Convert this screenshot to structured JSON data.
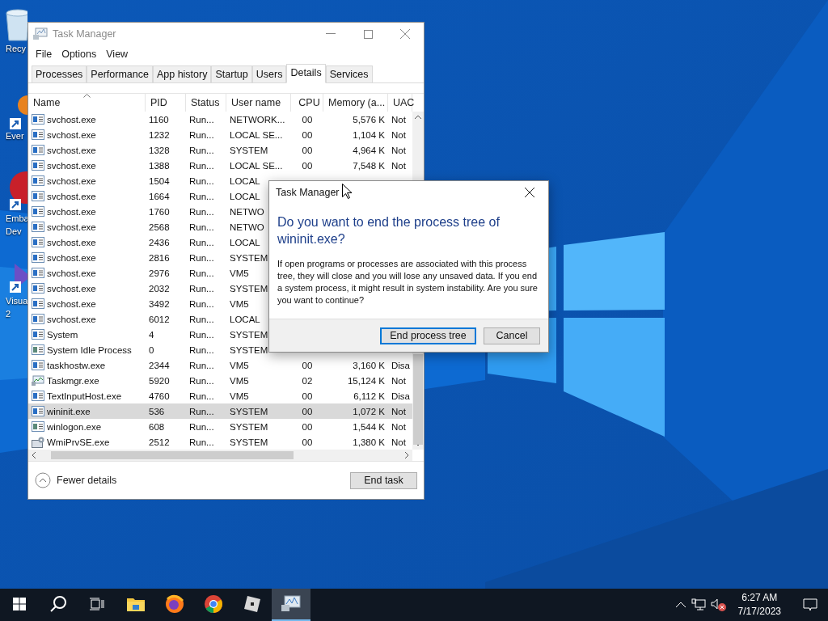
{
  "desktop": {
    "icons": [
      {
        "kind": "recycle",
        "lines": [
          "Recy"
        ]
      },
      {
        "kind": "evernote",
        "lines": [
          "Ever"
        ]
      },
      {
        "kind": "embarcadero",
        "lines": [
          "Emba",
          "Dev"
        ]
      },
      {
        "kind": "visualstudio",
        "lines": [
          "Visua",
          "2"
        ]
      }
    ]
  },
  "task_manager": {
    "title": "Task Manager",
    "menu": [
      "File",
      "Options",
      "View"
    ],
    "tabs": [
      {
        "label": "Processes",
        "selected": false
      },
      {
        "label": "Performance",
        "selected": false
      },
      {
        "label": "App history",
        "selected": false
      },
      {
        "label": "Startup",
        "selected": false
      },
      {
        "label": "Users",
        "selected": false
      },
      {
        "label": "Details",
        "selected": true
      },
      {
        "label": "Services",
        "selected": false
      }
    ],
    "columns": [
      {
        "label": "Name",
        "sorted": true
      },
      {
        "label": "PID",
        "sorted": false
      },
      {
        "label": "Status",
        "sorted": false
      },
      {
        "label": "User name",
        "sorted": false
      },
      {
        "label": "CPU",
        "sorted": false
      },
      {
        "label": "Memory (a...",
        "sorted": false
      },
      {
        "label": "UAC",
        "sorted": false
      }
    ],
    "rows": [
      {
        "kind": "app",
        "name": "svchost.exe",
        "pid": "1160",
        "status": "Run...",
        "user": "NETWORK...",
        "cpu": "00",
        "memory": "5,576 K",
        "uac": "Not",
        "selected": false
      },
      {
        "kind": "app",
        "name": "svchost.exe",
        "pid": "1232",
        "status": "Run...",
        "user": "LOCAL SE...",
        "cpu": "00",
        "memory": "1,104 K",
        "uac": "Not",
        "selected": false
      },
      {
        "kind": "app",
        "name": "svchost.exe",
        "pid": "1328",
        "status": "Run...",
        "user": "SYSTEM",
        "cpu": "00",
        "memory": "4,964 K",
        "uac": "Not",
        "selected": false
      },
      {
        "kind": "app",
        "name": "svchost.exe",
        "pid": "1388",
        "status": "Run...",
        "user": "LOCAL SE...",
        "cpu": "00",
        "memory": "7,548 K",
        "uac": "Not",
        "selected": false
      },
      {
        "kind": "app",
        "name": "svchost.exe",
        "pid": "1504",
        "status": "Run...",
        "user": "LOCAL",
        "selected": false
      },
      {
        "kind": "app",
        "name": "svchost.exe",
        "pid": "1664",
        "status": "Run...",
        "user": "LOCAL",
        "selected": false
      },
      {
        "kind": "app",
        "name": "svchost.exe",
        "pid": "1760",
        "status": "Run...",
        "user": "NETWO",
        "selected": false
      },
      {
        "kind": "app",
        "name": "svchost.exe",
        "pid": "2568",
        "status": "Run...",
        "user": "NETWO",
        "selected": false
      },
      {
        "kind": "app",
        "name": "svchost.exe",
        "pid": "2436",
        "status": "Run...",
        "user": "LOCAL",
        "selected": false
      },
      {
        "kind": "app",
        "name": "svchost.exe",
        "pid": "2816",
        "status": "Run...",
        "user": "SYSTEM",
        "selected": false
      },
      {
        "kind": "app",
        "name": "svchost.exe",
        "pid": "2976",
        "status": "Run...",
        "user": "VM5",
        "selected": false
      },
      {
        "kind": "app",
        "name": "svchost.exe",
        "pid": "2032",
        "status": "Run...",
        "user": "SYSTEM",
        "selected": false
      },
      {
        "kind": "app",
        "name": "svchost.exe",
        "pid": "3492",
        "status": "Run...",
        "user": "VM5",
        "selected": false
      },
      {
        "kind": "app",
        "name": "svchost.exe",
        "pid": "6012",
        "status": "Run...",
        "user": "LOCAL",
        "selected": false
      },
      {
        "kind": "app",
        "name": "System",
        "pid": "4",
        "status": "Run...",
        "user": "SYSTEM",
        "selected": false
      },
      {
        "kind": "idle",
        "name": "System Idle Process",
        "pid": "0",
        "status": "Run...",
        "user": "SYSTEM",
        "selected": false
      },
      {
        "kind": "app",
        "name": "taskhostw.exe",
        "pid": "2344",
        "status": "Run...",
        "user": "VM5",
        "cpu": "00",
        "memory": "3,160 K",
        "uac": "Disa",
        "selected": false
      },
      {
        "kind": "monitor",
        "name": "Taskmgr.exe",
        "pid": "5920",
        "status": "Run...",
        "user": "VM5",
        "cpu": "02",
        "memory": "15,124 K",
        "uac": "Not",
        "selected": false
      },
      {
        "kind": "app",
        "name": "TextInputHost.exe",
        "pid": "4760",
        "status": "Run...",
        "user": "VM5",
        "cpu": "00",
        "memory": "6,112 K",
        "uac": "Disa",
        "selected": false
      },
      {
        "kind": "app",
        "name": "wininit.exe",
        "pid": "536",
        "status": "Run...",
        "user": "SYSTEM",
        "cpu": "00",
        "memory": "1,072 K",
        "uac": "Not",
        "selected": true
      },
      {
        "kind": "idle",
        "name": "winlogon.exe",
        "pid": "608",
        "status": "Run...",
        "user": "SYSTEM",
        "cpu": "00",
        "memory": "1,544 K",
        "uac": "Not",
        "selected": false
      },
      {
        "kind": "wmi",
        "name": "WmiPrvSE.exe",
        "pid": "2512",
        "status": "Run...",
        "user": "SYSTEM",
        "cpu": "00",
        "memory": "1,380 K",
        "uac": "Not",
        "selected": false
      }
    ],
    "fewer_details": "Fewer details",
    "end_task": "End task"
  },
  "dialog": {
    "title": "Task Manager",
    "heading": "Do you want to end the process tree of wininit.exe?",
    "body": "If open programs or processes are associated with this process tree, they will close and you will lose any unsaved data. If you end a system process, it might result in system instability. Are you sure you want to continue?",
    "buttons": [
      {
        "label": "End process tree",
        "default": true
      },
      {
        "label": "Cancel",
        "default": false
      }
    ]
  },
  "taskbar": {
    "apps": [
      {
        "kind": "start",
        "active": false
      },
      {
        "kind": "search",
        "active": false
      },
      {
        "kind": "taskview",
        "active": false
      },
      {
        "kind": "explorer",
        "active": false
      },
      {
        "kind": "firefox",
        "active": false
      },
      {
        "kind": "chrome",
        "active": false
      },
      {
        "kind": "roblox",
        "active": false
      },
      {
        "kind": "taskmgr",
        "active": true
      }
    ],
    "time": "6:27 AM",
    "date": "7/17/2023"
  }
}
